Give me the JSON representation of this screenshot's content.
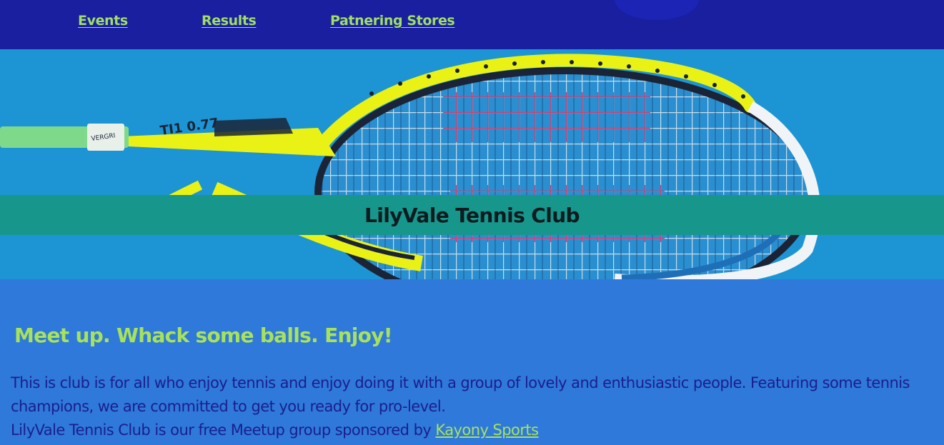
{
  "nav": {
    "events_label": "Events",
    "results_label": "Results",
    "stores_label": "Patnering Stores"
  },
  "hero": {
    "title": "LilyVale Tennis Club",
    "image": "tennis-racket-on-blue-court-image"
  },
  "main": {
    "tagline": "Meet up. Whack some balls. Enjoy!",
    "intro_line_1": "This is club is for all who enjoy tennis and enjoy doing it with a group of lovely and enthusiastic people. Featuring some tennis champions, we are committed to get you ready for pro-level.",
    "intro_line_2_prefix": "LilyVale Tennis Club is our free Meetup group sponsored by ",
    "sponsor_link": "Kayony Sports"
  },
  "colors": {
    "nav_bg": "#191f9e",
    "page_bg": "#2f79db",
    "accent_green": "#a7e25b",
    "band_teal": "#17968b",
    "text_dark_blue": "#1a1f8c"
  }
}
